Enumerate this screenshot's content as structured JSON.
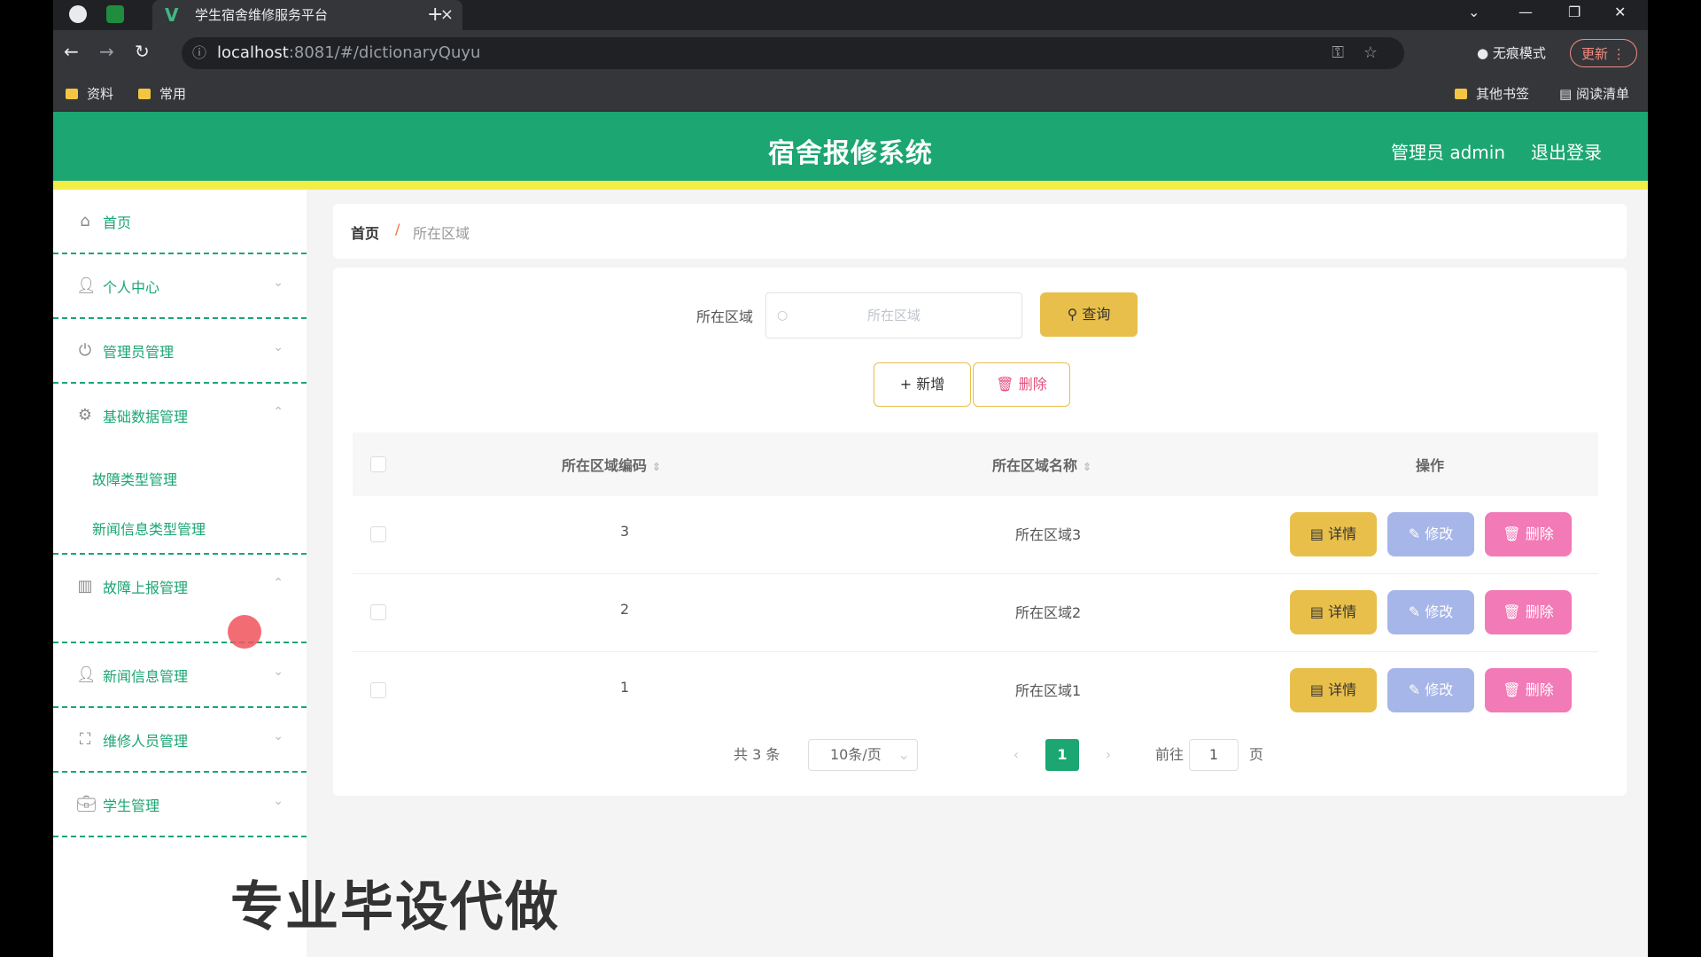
{
  "browser": {
    "tab_title": "学生宿舍维修服务平台",
    "tab_close": "×",
    "new_tab": "+",
    "url_host": "localhost",
    "url_path": ":8081/#/dictionaryQuyu",
    "incognito_label": "无痕模式",
    "update_label": "更新",
    "bookmarks": [
      "资料",
      "常用"
    ],
    "other_bookmarks": "其他书签",
    "reading_list": "阅读清单"
  },
  "header": {
    "title": "宿舍报修系统",
    "user": "管理员 admin",
    "logout": "退出登录"
  },
  "sidebar": {
    "items": [
      {
        "label": "首页",
        "icon": "home-icon"
      },
      {
        "label": "个人中心",
        "icon": "user-icon"
      },
      {
        "label": "管理员管理",
        "icon": "power-icon"
      },
      {
        "label": "基础数据管理",
        "icon": "settings-icon"
      },
      {
        "label": "故障上报管理",
        "icon": "chart-icon"
      },
      {
        "label": "新闻信息管理",
        "icon": "user-icon"
      },
      {
        "label": "维修人员管理",
        "icon": "fullscreen-icon"
      },
      {
        "label": "学生管理",
        "icon": "briefcase-icon"
      }
    ],
    "submenu": [
      "故障类型管理",
      "新闻信息类型管理"
    ]
  },
  "breadcrumb": {
    "home": "首页",
    "sep": "/",
    "current": "所在区域"
  },
  "search": {
    "label": "所在区域",
    "placeholder": "所在区域",
    "query_button": "查询"
  },
  "toolbar": {
    "add": "新增",
    "delete": "删除"
  },
  "table": {
    "columns": [
      "所在区域编码",
      "所在区域名称",
      "操作"
    ],
    "rows": [
      {
        "code": "3",
        "name": "所在区域3"
      },
      {
        "code": "2",
        "name": "所在区域2"
      },
      {
        "code": "1",
        "name": "所在区域1"
      }
    ],
    "actions": {
      "detail": "详情",
      "edit": "修改",
      "delete": "删除"
    }
  },
  "pagination": {
    "total": "共 3 条",
    "page_size": "10条/页",
    "current_page": "1",
    "goto_prefix": "前往",
    "goto_value": "1",
    "goto_suffix": "页"
  },
  "watermark": "专业毕设代做",
  "colors": {
    "primary": "#1ba672",
    "accent": "#f3ee47",
    "query": "#e8bf4a",
    "edit": "#a7b6e8",
    "danger": "#f27ab6"
  }
}
